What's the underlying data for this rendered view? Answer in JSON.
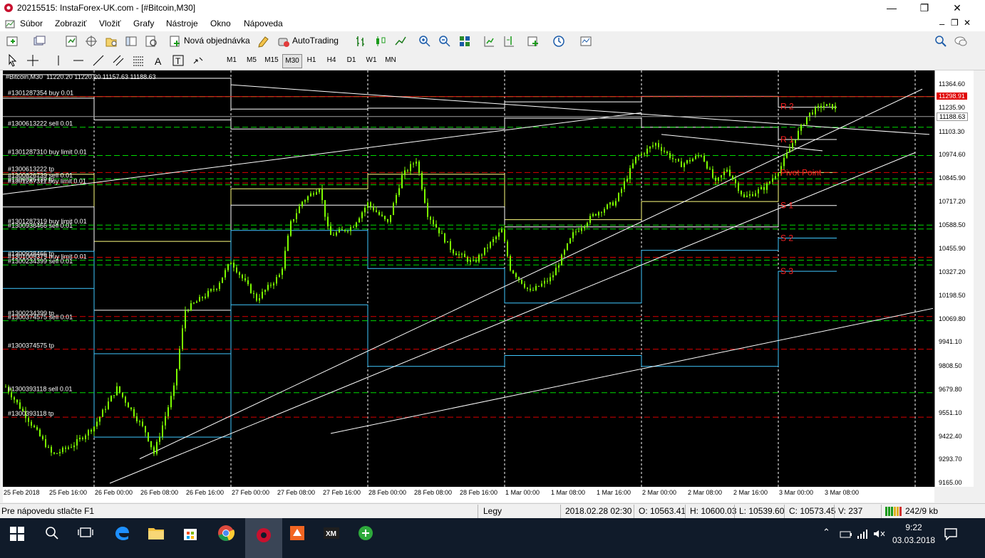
{
  "window": {
    "title": "20215515: InstaForex-UK.com - [#Bitcoin,M30]",
    "minimize": "—",
    "maximize": "❐",
    "close": "✕"
  },
  "menu": [
    "Súbor",
    "Zobraziť",
    "Vložiť",
    "Grafy",
    "Nástroje",
    "Okno",
    "Nápoveda"
  ],
  "toolbar": {
    "new_order": "Nová objednávka",
    "autotrading": "AutoTrading"
  },
  "timeframes": [
    "M1",
    "M5",
    "M15",
    "M30",
    "H1",
    "H4",
    "D1",
    "W1",
    "MN"
  ],
  "active_timeframe": "M30",
  "chart": {
    "header": "#Bitcoin,M30  11220.20 11220.20 11157.63 11188.63",
    "current_price_label": "11188.63",
    "top_price_label": "11298.91",
    "accent_colors": {
      "candle": "#7cfc00",
      "order_line": "#00ff00",
      "tp_line": "#ff0000",
      "pivot_text": "#ff2020",
      "upper_band": "#ffff80",
      "lower_band": "#40c8ff"
    },
    "price_ticks": [
      "11364.60",
      "11235.90",
      "11103.30",
      "10974.60",
      "10845.90",
      "10717.20",
      "10588.50",
      "10455.90",
      "10327.20",
      "10198.50",
      "10069.80",
      "9941.10",
      "9808.50",
      "9679.80",
      "9551.10",
      "9422.40",
      "9293.70",
      "9165.00"
    ],
    "time_ticks": [
      "25 Feb 2018",
      "25 Feb 16:00",
      "26 Feb 00:00",
      "26 Feb 08:00",
      "26 Feb 16:00",
      "27 Feb 00:00",
      "27 Feb 08:00",
      "27 Feb 16:00",
      "28 Feb 00:00",
      "28 Feb 08:00",
      "28 Feb 16:00",
      "1 Mar 00:00",
      "1 Mar 08:00",
      "1 Mar 16:00",
      "2 Mar 00:00",
      "2 Mar 08:00",
      "2 Mar 16:00",
      "3 Mar 00:00",
      "3 Mar 08:00"
    ],
    "order_labels": [
      {
        "text": "#1301287354 buy 0.01",
        "price": 11298.91,
        "kind": "order"
      },
      {
        "text": "#1300613222 sell 0.01",
        "price": 11130,
        "kind": "order"
      },
      {
        "text": "#1301287310 buy limit 0.01",
        "price": 10974,
        "kind": "order"
      },
      {
        "text": "#1300613222 tp",
        "price": 10880,
        "kind": "tp"
      },
      {
        "text": "#1300826739 sell 0.01",
        "price": 10845,
        "kind": "order"
      },
      {
        "text": "#1300826739 tp",
        "price": 10822,
        "kind": "tp"
      },
      {
        "text": "#1301287311 buy limit 0.01",
        "price": 10812,
        "kind": "order"
      },
      {
        "text": "#1301287319 buy limit 0.01",
        "price": 10590,
        "kind": "order"
      },
      {
        "text": "#1300938466 sell 0.01",
        "price": 10568,
        "kind": "order"
      },
      {
        "text": "#1300938466 tp",
        "price": 10412,
        "kind": "tp"
      },
      {
        "text": "#1301009379 buy limit 0.01",
        "price": 10396,
        "kind": "order"
      },
      {
        "text": "#1300234399 sell 0.01",
        "price": 10370,
        "kind": "order"
      },
      {
        "text": "#1300234399 tp",
        "price": 10085,
        "kind": "tp"
      },
      {
        "text": "#1300374575 sell 0.01",
        "price": 10062,
        "kind": "order"
      },
      {
        "text": "#1300374575 tp",
        "price": 9905,
        "kind": "tp"
      },
      {
        "text": "#1300393118 sell 0.01",
        "price": 9665,
        "kind": "order"
      },
      {
        "text": "#1300393118 tp",
        "price": 9530,
        "kind": "tp"
      }
    ],
    "pivot_labels": [
      {
        "text": "R 2",
        "price": 11245
      },
      {
        "text": "R 1",
        "price": 11062
      },
      {
        "text": "Pivot Point",
        "price": 10880
      },
      {
        "text": "S 1",
        "price": 10698
      },
      {
        "text": "S 2",
        "price": 10518
      },
      {
        "text": "S 3",
        "price": 10335
      }
    ]
  },
  "status": {
    "help": "Pre nápovedu stlačte F1",
    "profile": "Legy",
    "datetime": "2018.02.28 02:30",
    "open": "O: 10563.41",
    "high": "H: 10600.03",
    "low": "L: 10539.60",
    "close": "C: 10573.45",
    "volume": "V: 237",
    "traffic": "242/9 kb"
  },
  "taskbar": {
    "time": "9:22",
    "date": "03.03.2018"
  }
}
